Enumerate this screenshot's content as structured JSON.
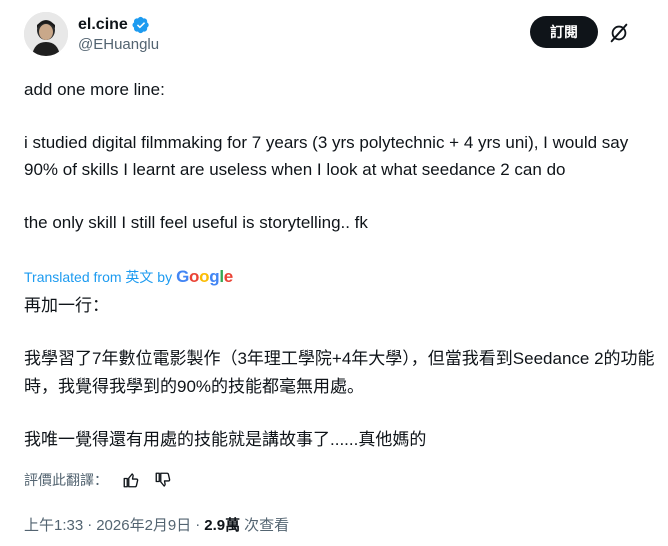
{
  "author": {
    "display_name": "el.cine",
    "handle": "@EHuanglu",
    "verified": true
  },
  "actions": {
    "subscribe_label": "訂閱",
    "grok_icon": "grok-icon"
  },
  "tweet": {
    "lines": [
      "add one more line:",
      "i studied digital filmmaking for 7 years (3 yrs polytechnic + 4 yrs uni), I would say 90% of skills I learnt are useless when I look at what seedance 2 can do",
      "the only skill I still feel useful is storytelling.. fk"
    ]
  },
  "translation": {
    "label": "Translated from 英文 by",
    "provider": "Google",
    "lines": [
      "再加一行：",
      "我學習了7年數位電影製作（3年理工學院+4年大學），但當我看到Seedance 2的功能時，我覺得我學到的90%的技能都毫無用處。",
      "我唯一覺得還有用處的技能就是講故事了......真他媽的"
    ],
    "rate_label": "評價此翻譯："
  },
  "meta": {
    "time": "上午1:33",
    "separator": "·",
    "date": "2026年2月9日",
    "views_count": "2.9萬",
    "views_label": "次查看"
  },
  "colors": {
    "text": "#0f1419",
    "secondary": "#536471",
    "link": "#1d9bf0",
    "verified": "#1d9bf0",
    "button_bg": "#0f1419"
  }
}
